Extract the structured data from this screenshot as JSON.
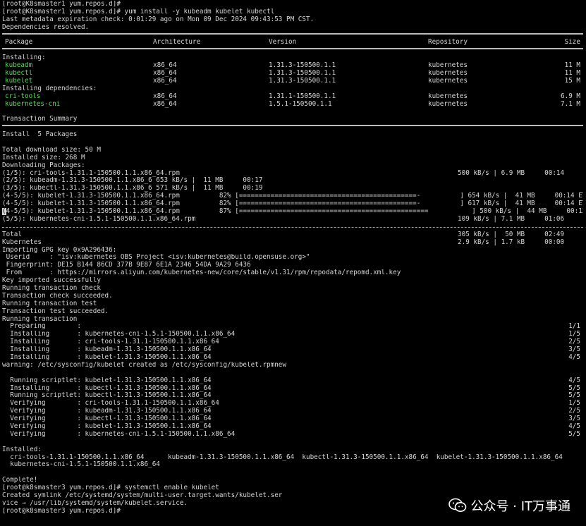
{
  "prompts": {
    "p1": "[root@K8smaster1 yum.repos.d]#",
    "p2": "[root@K8smaster1 yum.repos.d]# yum install -y kubeadm kubelet kubectl",
    "p3": "[root@k8smaster3 yum.repos.d]# systemctl enable kubelet",
    "p4": "[root@k8smaster3 yum.repos.d]#"
  },
  "header": {
    "metadata": "Last metadata expiration check: 0:01:29 ago on Mon 09 Dec 2024 09:43:53 PM CST.",
    "resolved": "Dependencies resolved."
  },
  "table": {
    "col_package": "Package",
    "col_arch": "Architecture",
    "col_version": "Version",
    "col_repo": "Repository",
    "col_size": "Size",
    "installing": "Installing:",
    "installing_deps": "Installing dependencies:",
    "rows": [
      {
        "name": "kubeadm",
        "arch": "x86_64",
        "version": "1.31.3-150500.1.1",
        "repo": "kubernetes",
        "size": "11 M"
      },
      {
        "name": "kubectl",
        "arch": "x86_64",
        "version": "1.31.3-150500.1.1",
        "repo": "kubernetes",
        "size": "11 M"
      },
      {
        "name": "kubelet",
        "arch": "x86_64",
        "version": "1.31.3-150500.1.1",
        "repo": "kubernetes",
        "size": "15 M"
      }
    ],
    "dep_rows": [
      {
        "name": "cri-tools",
        "arch": "x86_64",
        "version": "1.31.1-150500.1.1",
        "repo": "kubernetes",
        "size": "6.9 M"
      },
      {
        "name": "kubernetes-cni",
        "arch": "x86_64",
        "version": "1.5.1-150500.1.1",
        "repo": "kubernetes",
        "size": "7.1 M"
      }
    ]
  },
  "summary": {
    "title": "Transaction Summary",
    "install": "Install  5 Packages",
    "download": "Total download size: 50 M",
    "installed": "Installed size: 268 M",
    "downloading": "Downloading Packages:"
  },
  "downloads": [
    {
      "left": "(1/5): cri-tools-1.31.1-150500.1.1.x86_64.rpm",
      "right": "500 kB/s | 6.9 MB     00:14"
    },
    {
      "left": "(2/5): kubeadm-1.31.3-150500.1.1.x86_6 653 kB/s |  11 MB     00:17",
      "right": ""
    },
    {
      "left": "(3/5): kubectl-1.31.3-150500.1.1.x86_6 571 kB/s |  11 MB     00:19",
      "right": ""
    },
    {
      "left": "(4-5/5): kubelet-1.31.3-150500.1.1.x86_64.rpm          82% [=============================================-          ] 654 kB/s |  41 MB     00:14 ETA",
      "right": ""
    },
    {
      "left": "(4-5/5): kubelet-1.31.3-150500.1.1.x86_64.rpm          82% [=============================================-          ] 617 kB/s |  41 MB     00:14 ETA",
      "right": ""
    },
    {
      "left": "4-5/5): kubelet-1.31.3-150500.1.1.x86_64.rpm          87% [================================================           ] 500 kB/s |  44 MB     00:13 ETA",
      "right": ""
    },
    {
      "left": "(5/5): kubernetes-cni-1.5.1-150500.1.1.x86_64.rpm",
      "right": "109 kB/s | 7.1 MB     01:06"
    }
  ],
  "cursor_char": "(",
  "totals": [
    {
      "left": "Total",
      "right": "305 kB/s |  50 MB     02:49"
    },
    {
      "left": "Kubernetes",
      "right": "2.9 kB/s | 1.7 kB     00:00"
    }
  ],
  "gpg": [
    "Importing GPG key 0x9A296436:",
    " Userid     : \"isv:kubernetes OBS Project <isv:kubernetes@build.opensuse.org>\"",
    " Fingerprint: DE15 B144 86CD 377B 9E87 6E1A 2346 54DA 9A29 6436",
    " From       : https://mirrors.aliyun.com/kubernetes-new/core/stable/v1.31/rpm/repodata/repomd.xml.key",
    "Key imported successfully",
    "Running transaction check",
    "Transaction check succeeded.",
    "Running transaction test",
    "Transaction test succeeded.",
    "Running transaction"
  ],
  "steps1": [
    {
      "left": "  Preparing        :",
      "right": "1/1"
    },
    {
      "left": "  Installing       : kubernetes-cni-1.5.1-150500.1.1.x86_64",
      "right": "1/5"
    },
    {
      "left": "  Installing       : cri-tools-1.31.1-150500.1.1.x86_64",
      "right": "2/5"
    },
    {
      "left": "  Installing       : kubeadm-1.31.3-150500.1.1.x86_64",
      "right": "3/5"
    },
    {
      "left": "  Installing       : kubelet-1.31.3-150500.1.1.x86_64",
      "right": "4/5"
    }
  ],
  "warning": "warning: /etc/sysconfig/kubelet created as /etc/sysconfig/kubelet.rpmnew",
  "steps2": [
    {
      "left": "  Running scriptlet: kubelet-1.31.3-150500.1.1.x86_64",
      "right": "4/5"
    },
    {
      "left": "  Installing       : kubectl-1.31.3-150500.1.1.x86_64",
      "right": "5/5"
    },
    {
      "left": "  Running scriptlet: kubectl-1.31.3-150500.1.1.x86_64",
      "right": "5/5"
    },
    {
      "left": "  Verifying        : cri-tools-1.31.1-150500.1.1.x86_64",
      "right": "1/5"
    },
    {
      "left": "  Verifying        : kubeadm-1.31.3-150500.1.1.x86_64",
      "right": "2/5"
    },
    {
      "left": "  Verifying        : kubectl-1.31.3-150500.1.1.x86_64",
      "right": "3/5"
    },
    {
      "left": "  Verifying        : kubelet-1.31.3-150500.1.1.x86_64",
      "right": "4/5"
    },
    {
      "left": "  Verifying        : kubernetes-cni-1.5.1-150500.1.1.x86_64",
      "right": "5/5"
    }
  ],
  "installed": {
    "title": "Installed:",
    "line1": "  cri-tools-1.31.1-150500.1.1.x86_64      kubeadm-1.31.3-150500.1.1.x86_64  kubectl-1.31.3-150500.1.1.x86_64  kubelet-1.31.3-150500.1.1.x86_64",
    "line2": "  kubernetes-cni-1.5.1-150500.1.1.x86_64"
  },
  "complete": "Complete!",
  "symlink1": "Created symlink /etc/systemd/system/multi-user.target.wants/kubelet.ser",
  "symlink2": "vice → /usr/lib/systemd/system/kubelet.service.",
  "watermark": {
    "text": "公众号 · IT万事通",
    "icon": "wechat-icon"
  }
}
